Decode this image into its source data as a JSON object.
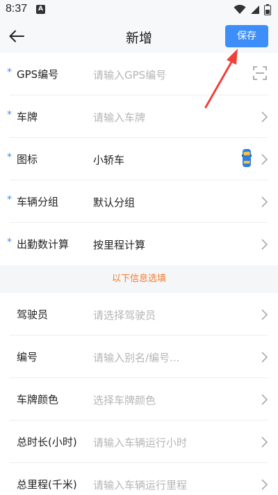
{
  "status_bar": {
    "time": "8:37",
    "notification_badge": "A",
    "icons": [
      "wifi-icon",
      "signal-icon",
      "battery-icon"
    ]
  },
  "app_bar": {
    "title": "新增",
    "save_label": "保存",
    "back_icon": "back-arrow-icon"
  },
  "required_fields": [
    {
      "label": "GPS编号",
      "value": "",
      "placeholder": "请输入GPS编号",
      "trailing_icon": "scan-icon"
    },
    {
      "label": "车牌",
      "value": "",
      "placeholder": "请输入车牌",
      "trailing_icon": "chevron-right-icon"
    },
    {
      "label": "图标",
      "value": "小轿车",
      "placeholder": "",
      "trailing_icon": "chevron-right-icon",
      "preview_icon": "car-icon"
    },
    {
      "label": "车辆分组",
      "value": "默认分组",
      "placeholder": "",
      "trailing_icon": "chevron-right-icon"
    },
    {
      "label": "出勤数计算",
      "value": "按里程计算",
      "placeholder": "",
      "trailing_icon": "chevron-right-icon"
    }
  ],
  "optional_section_title": "以下信息选填",
  "optional_fields": [
    {
      "label": "驾驶员",
      "placeholder": "请选择驾驶员",
      "trailing_icon": "chevron-right-icon"
    },
    {
      "label": "编号",
      "placeholder": "请输入别名/编号...",
      "trailing_icon": "chevron-right-icon"
    },
    {
      "label": "车牌颜色",
      "placeholder": "选择车牌颜色",
      "trailing_icon": "chevron-right-icon"
    },
    {
      "label": "总时长(小时)",
      "placeholder": "请输入车辆运行小时",
      "trailing_icon": "chevron-right-icon"
    },
    {
      "label": "总里程(千米)",
      "placeholder": "请输入车辆运行里程",
      "trailing_icon": "chevron-right-icon"
    }
  ],
  "colors": {
    "accent": "#3d8ef8",
    "optional_hint": "#f57a2a",
    "annotation_arrow": "#f0403c",
    "placeholder": "#b5b5b5"
  }
}
